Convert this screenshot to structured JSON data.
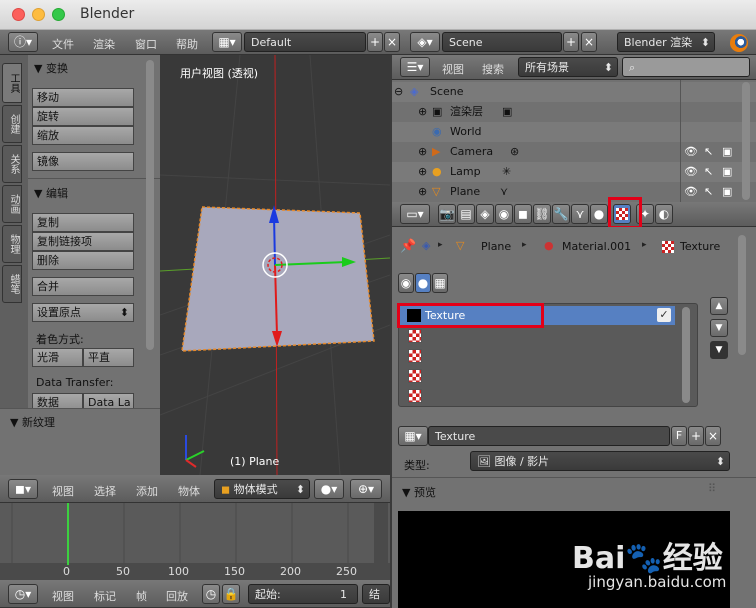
{
  "window": {
    "title": "Blender"
  },
  "colors": {
    "accent": "#5680c2",
    "red_highlight": "#e30018",
    "panel": "#727272"
  },
  "top_header": {
    "menus": [
      "文件",
      "渲染",
      "窗口",
      "帮助"
    ],
    "layout": "Default",
    "scene": "Scene",
    "engine": "Blender 渲染"
  },
  "tool_tabs": [
    "工具",
    "创建",
    "关系",
    "动画",
    "物理",
    "蜡笔"
  ],
  "tool_panel": {
    "transform_title": "▼ 变换",
    "transform_buttons": [
      "移动",
      "旋转",
      "缩放",
      "镜像"
    ],
    "edit_title": "▼ 编辑",
    "edit_buttons": [
      "复制",
      "复制链接项",
      "删除",
      "合并"
    ],
    "origin": "设置原点",
    "shading_label": "着色方式:",
    "smooth": "光滑",
    "flat": "平直",
    "data_transfer": "Data Transfer:",
    "data": "数据",
    "data_la": "Data La",
    "new_texture": "▼ 新纹理"
  },
  "viewport": {
    "label": "用户视图 (透视)",
    "object": "(1) Plane"
  },
  "outliner": {
    "menus": [
      "视图",
      "搜索"
    ],
    "filter": "所有场景",
    "rows": [
      {
        "name": "Scene"
      },
      {
        "name": "渲染层"
      },
      {
        "name": "World"
      },
      {
        "name": "Camera"
      },
      {
        "name": "Lamp"
      },
      {
        "name": "Plane"
      }
    ]
  },
  "props": {
    "breadcrumb": [
      "Plane",
      "Material.001",
      "Texture"
    ],
    "slot_selected": "Texture",
    "texture_name": "Texture",
    "f_label": "F",
    "type_label": "类型:",
    "type_value": "图像 / 影片",
    "preview_title": "▼ 预览"
  },
  "bottom_header": {
    "menus": [
      "视图",
      "选择",
      "添加",
      "物体"
    ],
    "mode": "物体模式"
  },
  "timeline": {
    "ticks": [
      "0",
      "50",
      "100",
      "150",
      "200",
      "250"
    ],
    "menus": [
      "视图",
      "标记",
      "帧",
      "回放"
    ],
    "start": "起始:",
    "start_val": "1",
    "end_prefix": "结"
  },
  "watermark": {
    "brand": "Bai",
    "brand2": "经验",
    "url": "jingyan.baidu.com"
  }
}
